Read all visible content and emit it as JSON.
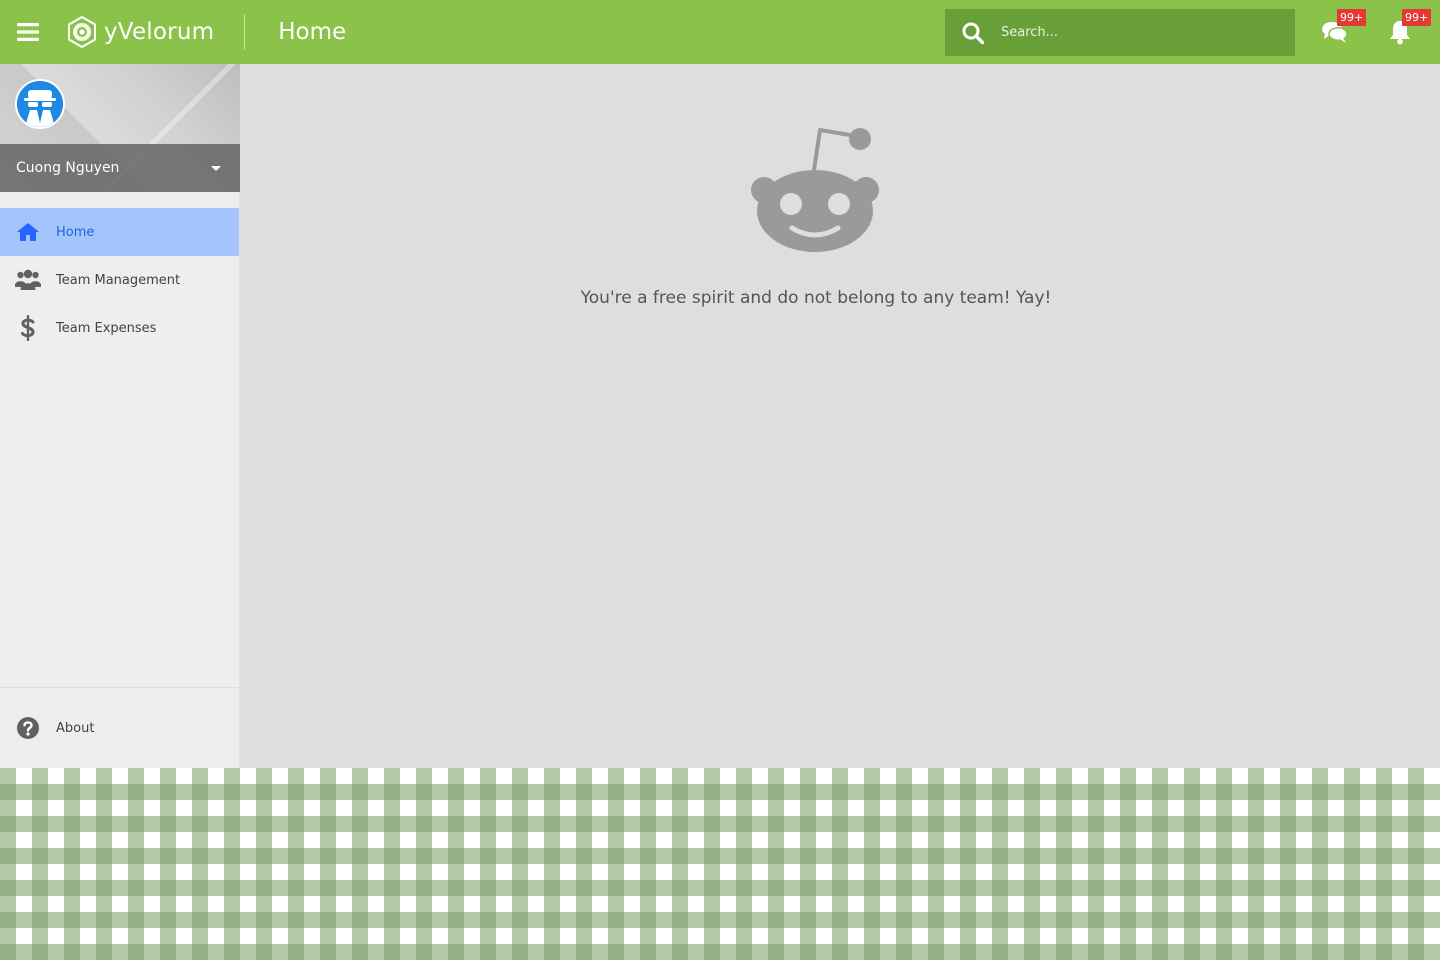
{
  "app": {
    "name": "yVelorum",
    "page_title": "Home",
    "accent_color": "#8bc34a",
    "search_bg_color": "#689f38",
    "badge_color": "#e53935"
  },
  "topbar": {
    "menu_icon": "hamburger-menu-icon",
    "search": {
      "placeholder": "Search..."
    },
    "messages": {
      "icon": "comments-icon",
      "badge": "99+"
    },
    "notifications": {
      "icon": "bell-icon",
      "badge": "99+"
    }
  },
  "sidebar": {
    "user": {
      "name": "Cuong Nguyen",
      "avatar_icon": "spy-avatar-icon"
    },
    "items": [
      {
        "label": "Home",
        "icon": "home-icon",
        "active": true
      },
      {
        "label": "Team Management",
        "icon": "users-icon",
        "active": false
      },
      {
        "label": "Team Expenses",
        "icon": "dollar-icon",
        "active": false
      }
    ],
    "footer": {
      "label": "About",
      "icon": "question-circle-icon"
    }
  },
  "main": {
    "illustration": "reddit-robot-icon",
    "message": "You're a free spirit and do not belong to any team! Yay!"
  }
}
